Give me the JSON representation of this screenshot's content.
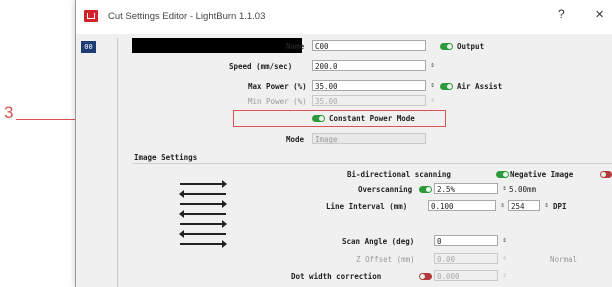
{
  "window": {
    "title": "Cut Settings Editor - LightBurn 1.1.03",
    "help_label": "?",
    "close_label": "✕"
  },
  "sidebar": {
    "layer_label": "00"
  },
  "callout": {
    "number": "3",
    "color": "#d9534f"
  },
  "settings": {
    "name": {
      "label": "Name",
      "value": "C00"
    },
    "output": {
      "label": "Output"
    },
    "speed": {
      "label": "Speed (mm/sec)",
      "value": "200.0"
    },
    "max_power": {
      "label": "Max Power (%)",
      "value": "35.00"
    },
    "air_assist": {
      "label": "Air Assist"
    },
    "min_power": {
      "label": "Min Power (%)",
      "value": "35.00"
    },
    "constant_power_mode": {
      "label": "Constant Power Mode"
    },
    "mode": {
      "label": "Mode",
      "value": "Image"
    }
  },
  "image_settings": {
    "header": "Image Settings",
    "bidirectional": {
      "label": "Bi-directional scanning"
    },
    "negative_image": {
      "label": "Negative Image"
    },
    "overscanning": {
      "label": "Overscanning",
      "value": "2.5%",
      "extra": "5.00mm"
    },
    "line_interval": {
      "label": "Line Interval (mm)",
      "value": "0.100",
      "dpi_value": "254",
      "dpi_label": "DPI"
    },
    "scan_angle": {
      "label": "Scan Angle (deg)",
      "value": "0"
    },
    "z_offset": {
      "label": "Z Offset (mm)",
      "value": "0.00",
      "unit": "Normal"
    },
    "dot_width": {
      "label": "Dot width correction",
      "value": "0.000"
    }
  },
  "colors": {
    "accent_red": "#d2232a",
    "toggle_on": "#2e9a3e",
    "toggle_off": "#b23a3a",
    "layer_tab": "#1c3d73"
  }
}
